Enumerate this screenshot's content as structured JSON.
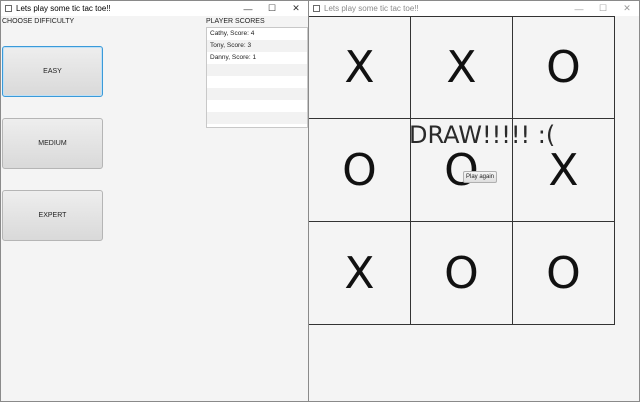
{
  "windows": {
    "left": {
      "title": "Lets play some tic tac toe!!",
      "controls": [
        "—",
        "☐",
        "✕"
      ],
      "difficulty_label": "CHOOSE DIFFICULTY",
      "buttons": {
        "easy": "EASY",
        "medium": "MEDIUM",
        "expert": "EXPERT"
      },
      "scores_label": "PLAYER SCORES",
      "scores": [
        "Cathy, Score: 4",
        "Tony, Score: 3",
        "Danny, Score: 1"
      ]
    },
    "right": {
      "title": "Lets play some tic tac toe!!",
      "controls": [
        "—",
        "☐",
        "✕"
      ],
      "board": [
        "X",
        "X",
        "O",
        "O",
        "O",
        "X",
        "X",
        "O",
        "O"
      ],
      "result": "DRAW!!!!! :(",
      "play_again": "Play again"
    }
  }
}
